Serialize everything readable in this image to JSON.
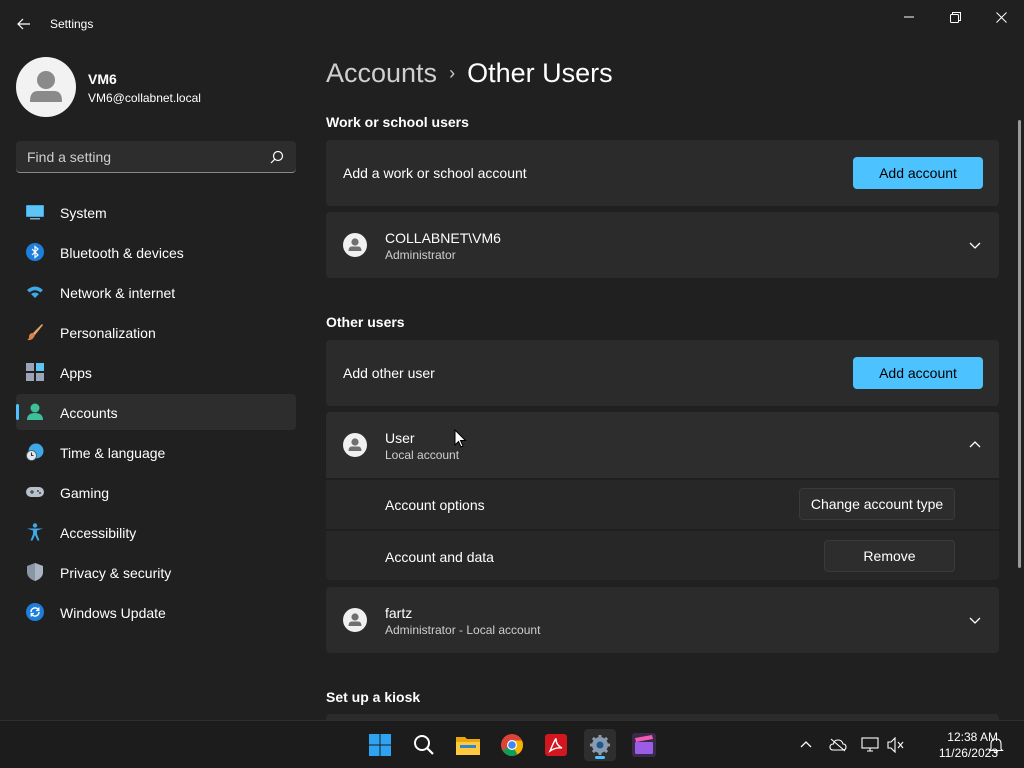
{
  "window": {
    "app_title": "Settings"
  },
  "profile": {
    "name": "VM6",
    "email": "VM6@collabnet.local"
  },
  "search": {
    "placeholder": "Find a setting"
  },
  "sidebar": {
    "items": [
      {
        "label": "System",
        "icon": "system-icon"
      },
      {
        "label": "Bluetooth & devices",
        "icon": "bluetooth-icon"
      },
      {
        "label": "Network & internet",
        "icon": "wifi-icon"
      },
      {
        "label": "Personalization",
        "icon": "brush-icon"
      },
      {
        "label": "Apps",
        "icon": "apps-icon"
      },
      {
        "label": "Accounts",
        "icon": "accounts-icon",
        "selected": true
      },
      {
        "label": "Time & language",
        "icon": "globe-clock-icon"
      },
      {
        "label": "Gaming",
        "icon": "gamepad-icon"
      },
      {
        "label": "Accessibility",
        "icon": "accessibility-icon"
      },
      {
        "label": "Privacy & security",
        "icon": "shield-icon"
      },
      {
        "label": "Windows Update",
        "icon": "windows-update-icon"
      }
    ]
  },
  "breadcrumb": {
    "parent": "Accounts",
    "separator": "›",
    "current": "Other Users"
  },
  "work_school": {
    "title": "Work or school users",
    "add_label": "Add a work or school account",
    "add_button": "Add account",
    "users": [
      {
        "name": "COLLABNET\\VM6",
        "role": "Administrator",
        "expanded": false
      }
    ]
  },
  "other_users": {
    "title": "Other users",
    "add_label": "Add other user",
    "add_button": "Add account",
    "users": [
      {
        "name": "User",
        "role": "Local account",
        "expanded": true,
        "options": [
          {
            "label": "Account options",
            "button": "Change account type"
          },
          {
            "label": "Account and data",
            "button": "Remove"
          }
        ]
      },
      {
        "name": "fartz",
        "role": "Administrator - Local account",
        "expanded": false
      }
    ]
  },
  "kiosk": {
    "title": "Set up a kiosk"
  },
  "taskbar": {
    "apps": [
      "start-icon",
      "search-icon",
      "file-explorer-icon",
      "chrome-icon",
      "acrobat-icon",
      "settings-icon",
      "clipchamp-icon"
    ],
    "active_app": "settings-icon"
  },
  "tray": {
    "time": "12:38 AM",
    "date": "11/26/2023"
  },
  "colors": {
    "accent": "#4cc2ff",
    "background": "#202020",
    "card": "#2b2b2b"
  }
}
